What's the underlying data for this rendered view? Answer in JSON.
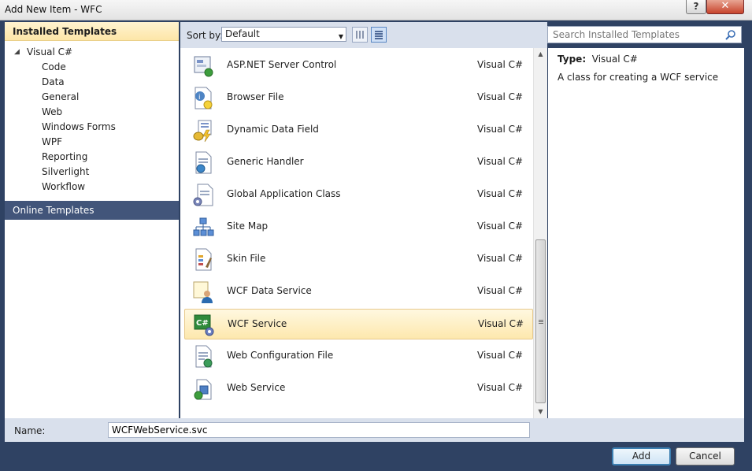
{
  "window": {
    "title": "Add New Item - WFC",
    "help_label": "?",
    "close_label": "✕"
  },
  "left_pane": {
    "installed_header": "Installed Templates",
    "tree_root": "Visual C#",
    "tree_items": [
      "Code",
      "Data",
      "General",
      "Web",
      "Windows Forms",
      "WPF",
      "Reporting",
      "Silverlight",
      "Workflow"
    ],
    "selected_item": "Web",
    "online_header": "Online Templates"
  },
  "toolbar": {
    "sort_label": "Sort by:",
    "sort_value": "Default"
  },
  "search": {
    "placeholder": "Search Installed Templates"
  },
  "templates": [
    {
      "name": "ASP.NET Server Control",
      "language": "Visual C#",
      "icon": "server-control-icon"
    },
    {
      "name": "Browser File",
      "language": "Visual C#",
      "icon": "browser-file-icon"
    },
    {
      "name": "Dynamic Data Field",
      "language": "Visual C#",
      "icon": "dynamic-data-field-icon"
    },
    {
      "name": "Generic Handler",
      "language": "Visual C#",
      "icon": "generic-handler-icon"
    },
    {
      "name": "Global Application Class",
      "language": "Visual C#",
      "icon": "global-application-class-icon"
    },
    {
      "name": "Site Map",
      "language": "Visual C#",
      "icon": "site-map-icon"
    },
    {
      "name": "Skin File",
      "language": "Visual C#",
      "icon": "skin-file-icon"
    },
    {
      "name": "WCF Data Service",
      "language": "Visual C#",
      "icon": "wcf-data-service-icon"
    },
    {
      "name": "WCF Service",
      "language": "Visual C#",
      "icon": "wcf-service-icon",
      "selected": true
    },
    {
      "name": "Web Configuration File",
      "language": "Visual C#",
      "icon": "web-config-file-icon"
    },
    {
      "name": "Web Service",
      "language": "Visual C#",
      "icon": "web-service-icon"
    }
  ],
  "details": {
    "type_label": "Type:",
    "type_value": "Visual C#",
    "description": "A class for creating a WCF service"
  },
  "name_field": {
    "label": "Name:",
    "value": "WCFWebService.svc"
  },
  "buttons": {
    "add": "Add",
    "cancel": "Cancel"
  }
}
